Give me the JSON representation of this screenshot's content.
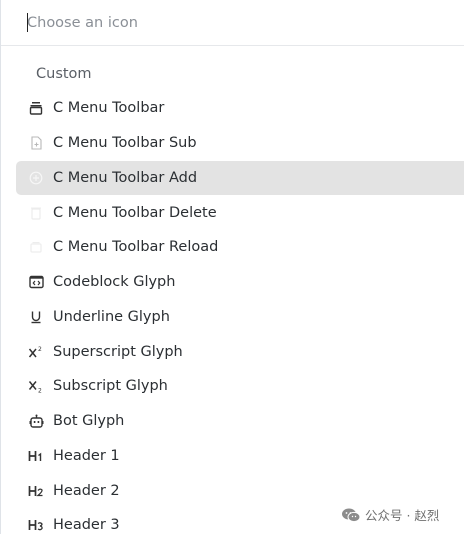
{
  "search": {
    "placeholder": "Choose an icon"
  },
  "group": {
    "label": "Custom"
  },
  "items": [
    {
      "label": "C Menu Toolbar",
      "icon": "toolbar-icon"
    },
    {
      "label": "C Menu Toolbar Sub",
      "icon": "file-plus-icon"
    },
    {
      "label": "C Menu Toolbar Add",
      "icon": "circle-plus-icon",
      "selected": true
    },
    {
      "label": "C Menu Toolbar Delete",
      "icon": "trash-icon"
    },
    {
      "label": "C Menu Toolbar Reload",
      "icon": "tray-icon"
    },
    {
      "label": "Codeblock Glyph",
      "icon": "codeblock-icon"
    },
    {
      "label": "Underline Glyph",
      "icon": "underline-icon"
    },
    {
      "label": "Superscript Glyph",
      "icon": "superscript-icon"
    },
    {
      "label": "Subscript Glyph",
      "icon": "subscript-icon"
    },
    {
      "label": "Bot Glyph",
      "icon": "bot-icon"
    },
    {
      "label": "Header 1",
      "icon": "h1-icon"
    },
    {
      "label": "Header 2",
      "icon": "h2-icon"
    },
    {
      "label": "Header 3",
      "icon": "h3-icon"
    }
  ],
  "watermark": {
    "text": "公众号 · 赵烈"
  },
  "colors": {
    "selected_bg": "#e3e3e3",
    "text": "#2b2f33",
    "muted": "#5a5f66"
  }
}
